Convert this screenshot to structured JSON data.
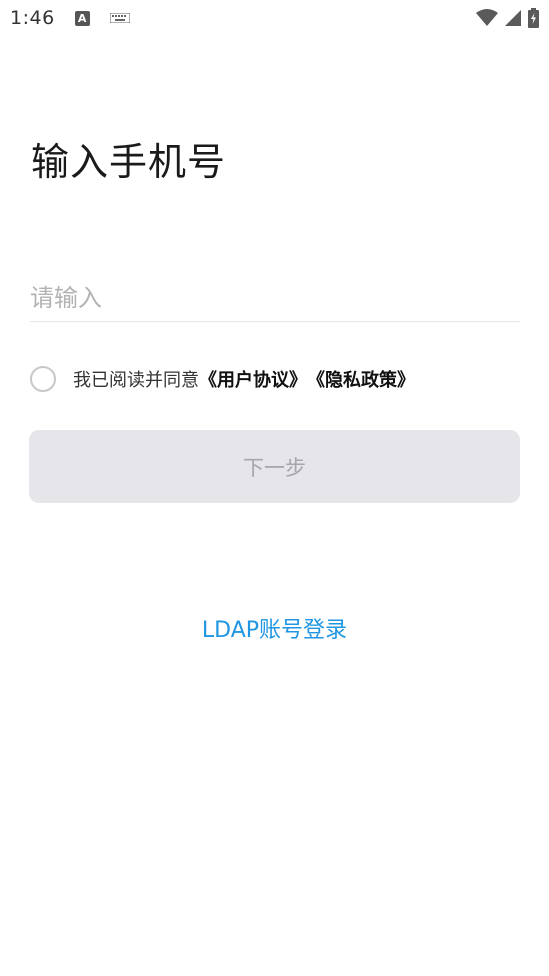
{
  "status_bar": {
    "time": "1:46",
    "notification_icon_letter": "A",
    "icons": [
      "a-notification-icon",
      "keyboard-icon",
      "wifi-icon",
      "cell-signal-icon",
      "battery-charging-icon"
    ]
  },
  "page": {
    "title": "输入手机号"
  },
  "phone_input": {
    "value": "",
    "placeholder": "请输入"
  },
  "agreement": {
    "prefix": "我已阅读并同意",
    "user_agreement": "《用户协议》",
    "privacy_policy": "《隐私政策》",
    "checked": false
  },
  "next_button": {
    "label": "下一步"
  },
  "ldap_link": {
    "label": "LDAP账号登录"
  },
  "colors": {
    "accent": "#2196e3",
    "button_disabled_bg": "#e5e5ea",
    "button_disabled_text": "#a6a6aa"
  }
}
